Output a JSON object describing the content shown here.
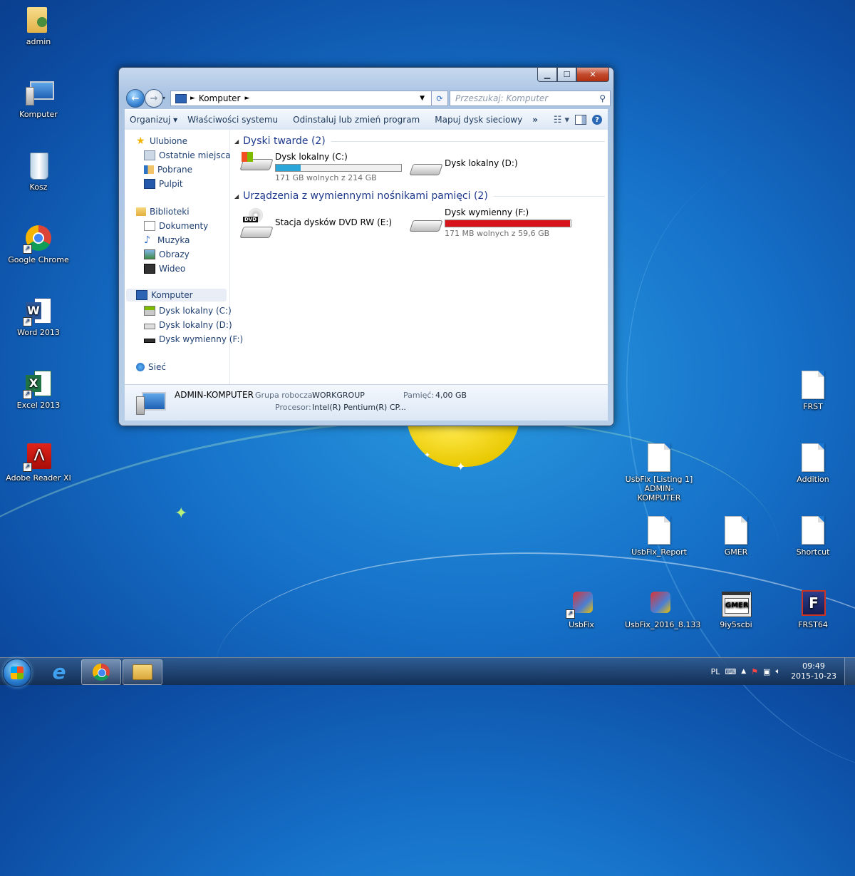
{
  "desktop": {
    "left_icons": [
      {
        "label": "admin"
      },
      {
        "label": "Komputer"
      },
      {
        "label": "Kosz"
      },
      {
        "label": "Google Chrome"
      },
      {
        "label": "Word 2013"
      },
      {
        "label": "Excel 2013"
      },
      {
        "label": "Adobe Reader XI"
      }
    ],
    "right_icons": {
      "frst": "FRST",
      "usbfix_listing_line1": "UsbFix [Listing 1]",
      "usbfix_listing_line2": "ADMIN-KOMPUTER",
      "addition": "Addition",
      "usbfix_report": "UsbFix_Report",
      "gmer": "GMER",
      "shortcut": "Shortcut",
      "usbfix": "UsbFix",
      "usbfix_2016": "UsbFix_2016_8.133",
      "random_exe": "9iy5scbi",
      "frst64": "FRST64",
      "gmer_icon_text": "GMER"
    }
  },
  "window": {
    "address_path": "Komputer",
    "search_placeholder": "Przeszukaj: Komputer",
    "toolbar": {
      "organize": "Organizuj ▾",
      "system_properties": "Właściwości systemu",
      "uninstall": "Odinstaluj lub zmień program",
      "map_drive": "Mapuj dysk sieciowy",
      "more": "»"
    },
    "nav": {
      "favorites": "Ulubione",
      "recent_places": "Ostatnie miejsca",
      "downloads": "Pobrane",
      "desktop": "Pulpit",
      "libraries": "Biblioteki",
      "documents": "Dokumenty",
      "music": "Muzyka",
      "pictures": "Obrazy",
      "videos": "Wideo",
      "computer": "Komputer",
      "drive_c": "Dysk lokalny (C:)",
      "drive_d": "Dysk lokalny (D:)",
      "drive_f": "Dysk wymienny (F:)",
      "network": "Sieć"
    },
    "groups": {
      "hard_disks": "Dyski twarde (2)",
      "removable": "Urządzenia z wymiennymi nośnikami pamięci (2)"
    },
    "drives": {
      "c": {
        "name": "Dysk lokalny (C:)",
        "free": "171 GB wolnych z 214 GB",
        "used_fraction": 0.2,
        "bar_color": "#2aa6d8"
      },
      "d": {
        "name": "Dysk lokalny (D:)"
      },
      "e": {
        "name": "Stacja dysków DVD RW (E:)",
        "dvd_label": "DVD"
      },
      "f": {
        "name": "Dysk wymienny (F:)",
        "free": "171 MB wolnych z 59,6 GB",
        "used_fraction": 0.997,
        "bar_color": "#d8141b"
      }
    },
    "details": {
      "computer_name": "ADMIN-KOMPUTER",
      "workgroup_label": "Grupa robocza:",
      "workgroup_value": "WORKGROUP",
      "memory_label": "Pamięć:",
      "memory_value": "4,00 GB",
      "cpu_label": "Procesor:",
      "cpu_value": "Intel(R) Pentium(R) CP..."
    }
  },
  "taskbar": {
    "language": "PL",
    "time": "09:49",
    "date": "2015-10-23"
  }
}
